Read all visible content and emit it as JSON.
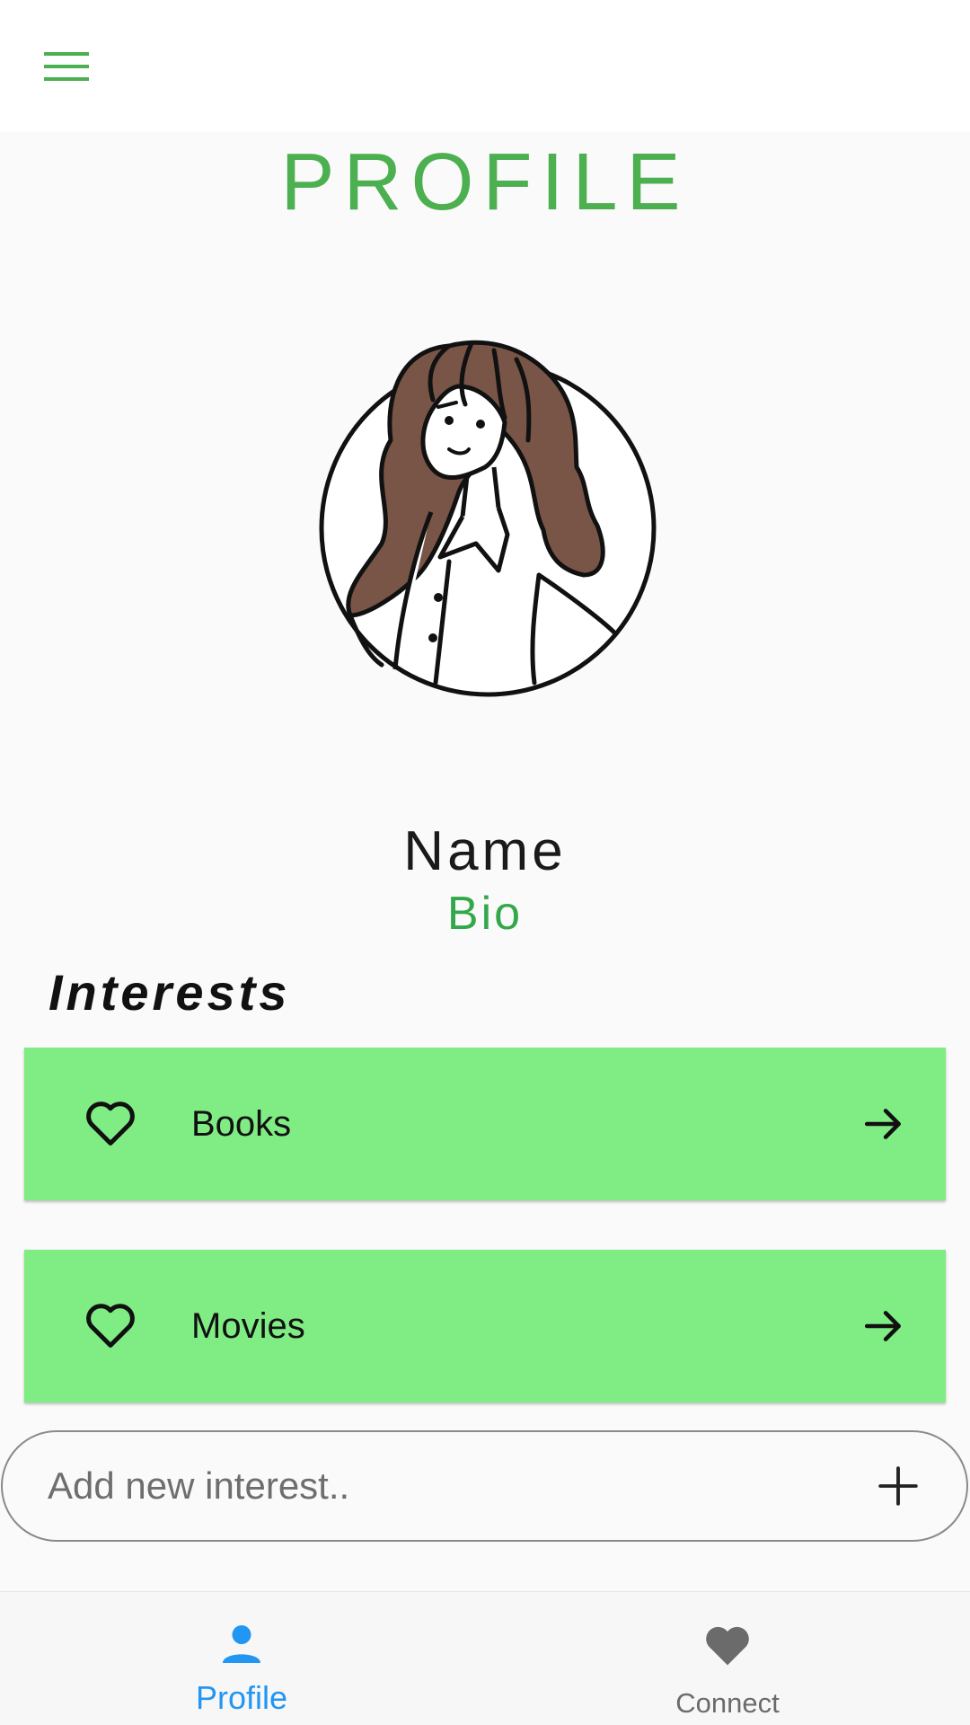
{
  "appbar": {
    "menu_icon": "menu-icon"
  },
  "page": {
    "title": "PROFILE"
  },
  "profile": {
    "avatar": "woman-illustration-avatar",
    "name": "Name",
    "bio": "Bio"
  },
  "interests": {
    "heading": "Interests",
    "items": [
      {
        "label": "Books",
        "icon": "heart-outline-icon",
        "action_icon": "arrow-right-icon"
      },
      {
        "label": "Movies",
        "icon": "heart-outline-icon",
        "action_icon": "arrow-right-icon"
      }
    ],
    "input_placeholder": "Add new interest..",
    "input_value": "",
    "add_icon": "plus-icon"
  },
  "bottom_nav": {
    "items": [
      {
        "label": "Profile",
        "icon": "person-icon",
        "active": true
      },
      {
        "label": "Connect",
        "icon": "heart-filled-icon",
        "active": false
      }
    ]
  },
  "colors": {
    "accent": "#4caf50",
    "bio": "#33a84a",
    "card": "#80ed84",
    "nav_active": "#2196f3",
    "nav_inactive": "#6b6b6b"
  }
}
